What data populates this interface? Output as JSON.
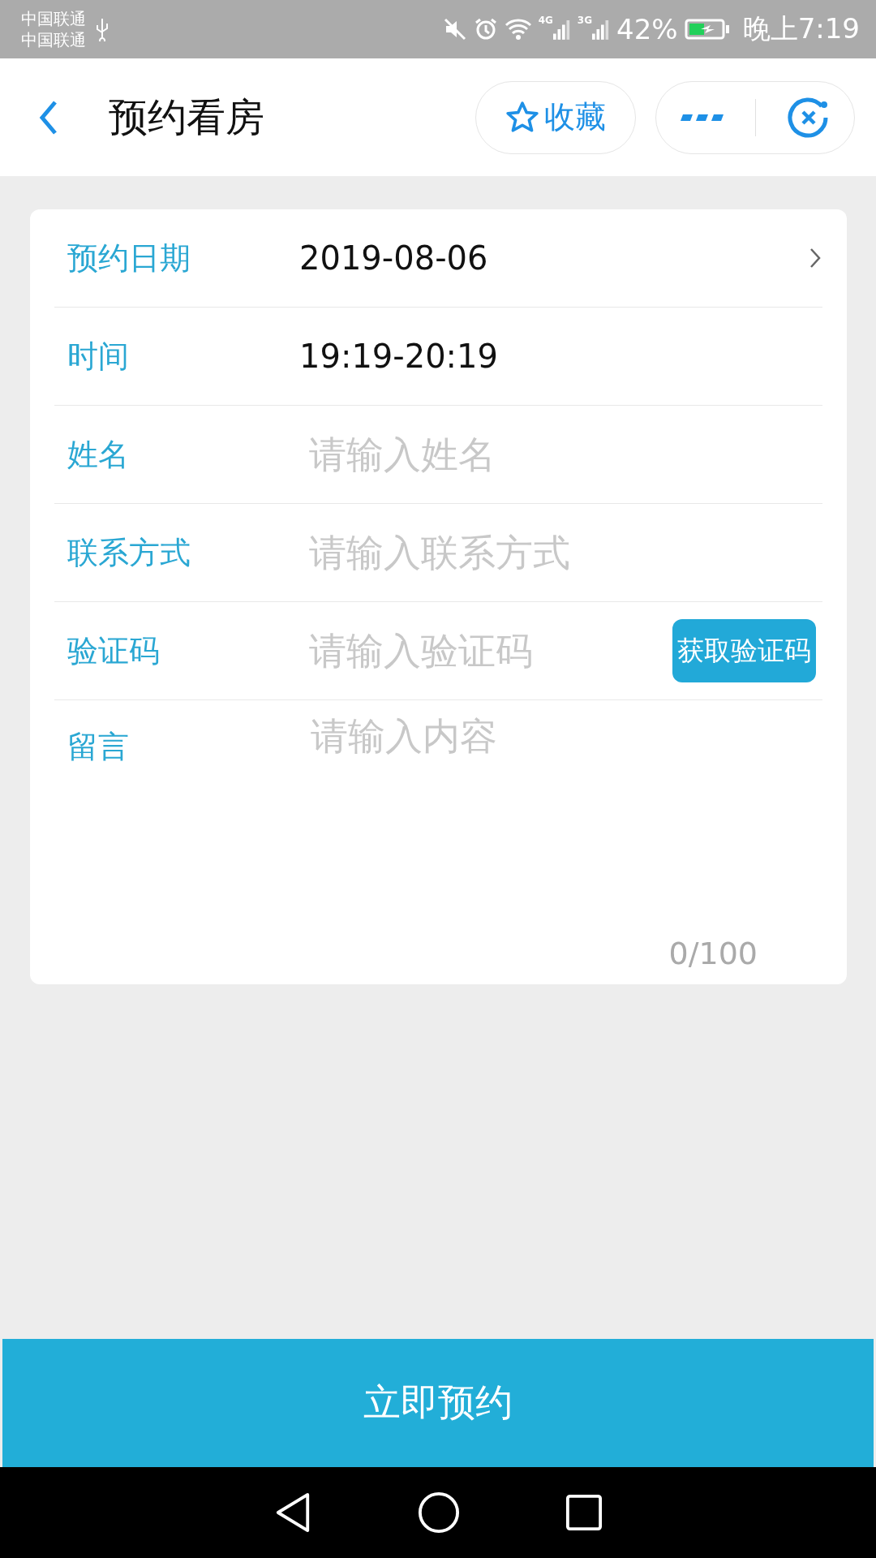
{
  "status_bar": {
    "carriers": [
      "中国联通",
      "中国联通"
    ],
    "network_labels": [
      "4G",
      "3G"
    ],
    "battery": "42%",
    "time": "晚上7:19"
  },
  "header": {
    "title": "预约看房",
    "favorite": "收藏"
  },
  "form": {
    "rows": [
      {
        "kind": "picker",
        "label": "预约日期",
        "value": "2019-08-06"
      },
      {
        "kind": "text",
        "label": "时间",
        "value": "19:19-20:19"
      },
      {
        "kind": "input",
        "label": "姓名",
        "placeholder": "请输入姓名"
      },
      {
        "kind": "input",
        "label": "联系方式",
        "placeholder": "请输入联系方式"
      },
      {
        "kind": "code",
        "label": "验证码",
        "placeholder": "请输入验证码",
        "button": "获取验证码"
      },
      {
        "kind": "textarea",
        "label": "留言",
        "placeholder": "请输入内容",
        "counter": "0/100"
      }
    ]
  },
  "submit": "立即预约"
}
